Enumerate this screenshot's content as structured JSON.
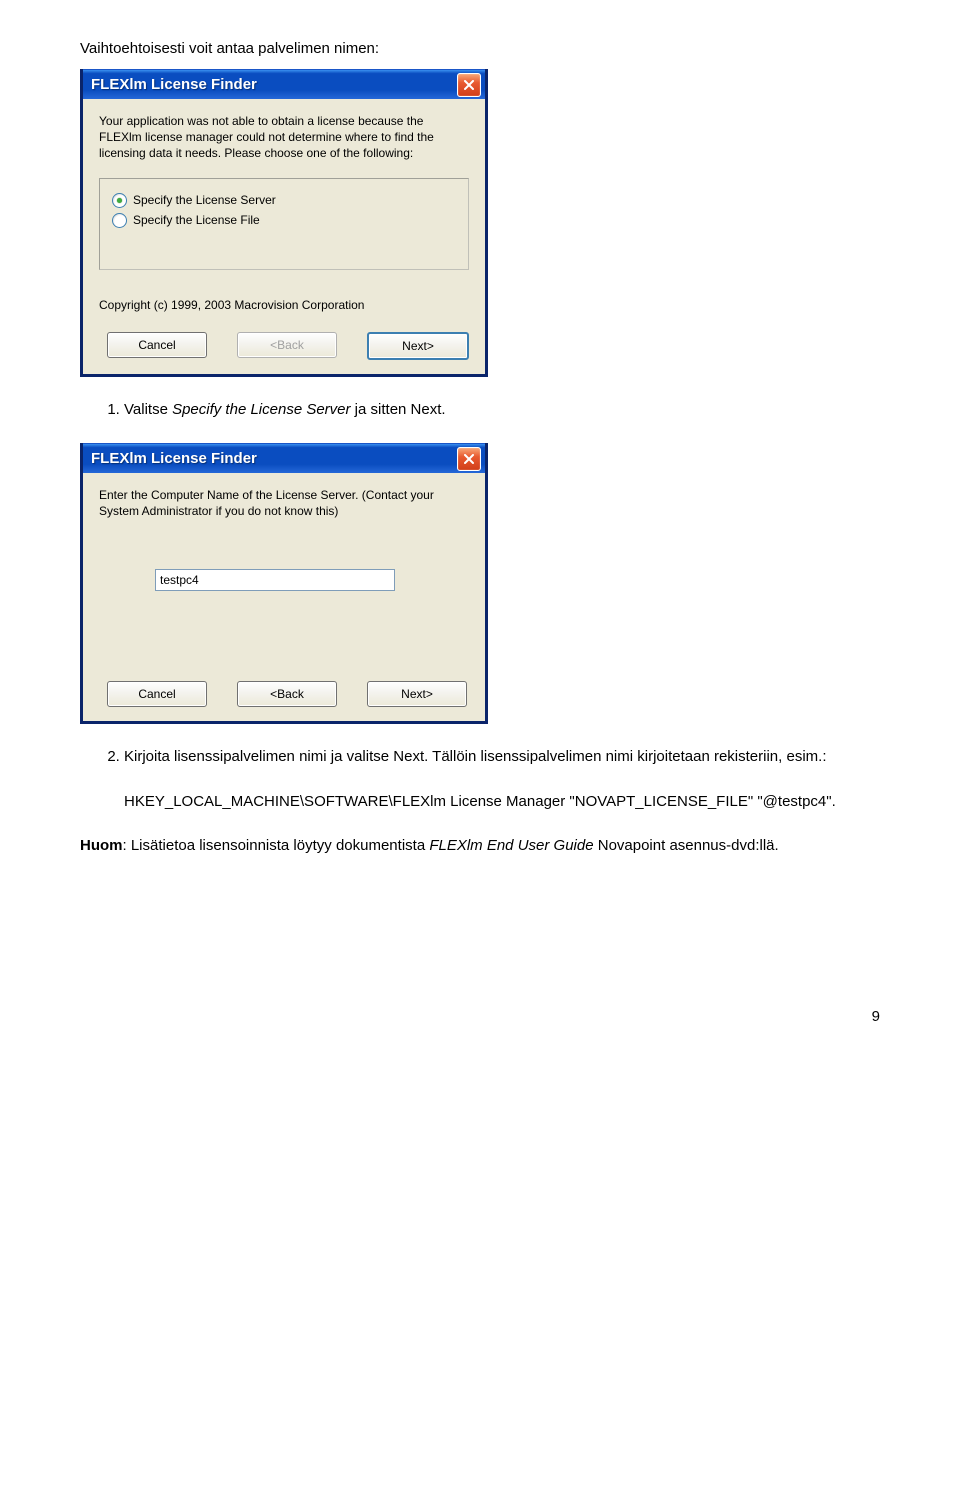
{
  "intro": "Vaihtoehtoisesti voit antaa palvelimen nimen:",
  "dialog1": {
    "title": "FLEXlm License Finder",
    "body_text": "Your application was not able to obtain a license because the FLEXlm license manager could not determine where to find the licensing data it needs.  Please choose one of the following:",
    "radio_options": [
      {
        "label": "Specify the License Server",
        "selected": true
      },
      {
        "label": "Specify the License File",
        "selected": false
      }
    ],
    "copyright": "Copyright (c) 1999, 2003 Macrovision Corporation",
    "buttons": {
      "cancel": "Cancel",
      "back": "<Back",
      "next": "Next>"
    }
  },
  "step1": {
    "number": "1.",
    "prefix": "Valitse ",
    "italic": "Specify the License Server",
    "suffix": " ja sitten Next."
  },
  "dialog2": {
    "title": "FLEXlm License Finder",
    "body_text": "Enter the Computer Name of the License Server. (Contact your System Administrator if you do not know this)",
    "input_value": "testpc4",
    "buttons": {
      "cancel": "Cancel",
      "back": "<Back",
      "next": "Next>"
    }
  },
  "step2": {
    "number": "2.",
    "text_a": "Kirjoita lisenssipalvelimen nimi ja valitse Next. Tällöin lisenssipalvelimen nimi kirjoitetaan rekisteriin, esim.:",
    "code": "HKEY_LOCAL_MACHINE\\SOFTWARE\\FLEXlm License Manager \"NOVAPT_LICENSE_FILE\" \"@testpc4\"."
  },
  "final_note": {
    "bold": "Huom",
    "middle": ": Lisätietoa lisensoinnista löytyy dokumentista ",
    "italic": "FLEXlm End User Guide",
    "suffix": " Novapoint asennus-dvd:llä."
  },
  "page_number": "9"
}
